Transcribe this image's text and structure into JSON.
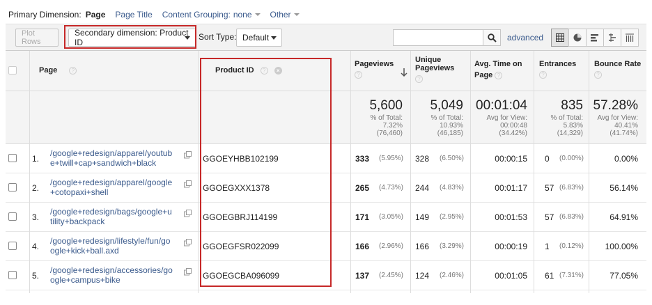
{
  "dimensions": {
    "primary_label": "Primary Dimension:",
    "page": "Page",
    "page_title": "Page Title",
    "content_grouping_label": "Content Grouping:",
    "content_grouping_value": "none",
    "other": "Other"
  },
  "toolbar": {
    "plot_rows": "Plot Rows",
    "secondary_dimension": "Secondary dimension: Product ID",
    "sort_type_label": "Sort Type:",
    "sort_type_value": "Default",
    "search_placeholder": "",
    "advanced": "advanced"
  },
  "columns": {
    "page": "Page",
    "product_id": "Product ID",
    "pageviews": "Pageviews",
    "unique_line1": "Unique",
    "unique_line2": "Pageviews",
    "avg_line1": "Avg. Time on",
    "avg_line2": "Page",
    "entrances": "Entrances",
    "bounce": "Bounce Rate"
  },
  "totals": {
    "pageviews": {
      "big": "5,600",
      "l1": "% of Total:",
      "l2": "7.32%",
      "l3": "(76,460)"
    },
    "unique": {
      "big": "5,049",
      "l1": "% of Total:",
      "l2": "10.93%",
      "l3": "(46,185)"
    },
    "avg": {
      "big": "00:01:04",
      "l1": "Avg for View:",
      "l2": "00:00:48",
      "l3": "(34.42%)"
    },
    "entrances": {
      "big": "835",
      "l1": "% of Total:",
      "l2": "5.83%",
      "l3": "(14,329)"
    },
    "bounce": {
      "big": "57.28%",
      "l1": "Avg for View:",
      "l2": "40.41%",
      "l3": "(41.74%)"
    }
  },
  "rows": [
    {
      "num": "1.",
      "page1": "/google+redesign/apparel/youtub",
      "page2": "e+twill+cap+sandwich+black",
      "product": "GGOEYHBB102199",
      "pv": "333",
      "pv_pct": "(5.95%)",
      "upv": "328",
      "upv_pct": "(6.50%)",
      "avg": "00:00:15",
      "ent": "0",
      "ent_pct": "(0.00%)",
      "bounce": "0.00%"
    },
    {
      "num": "2.",
      "page1": "/google+redesign/apparel/google",
      "page2": "+cotopaxi+shell",
      "product": "GGOEGXXX1378",
      "pv": "265",
      "pv_pct": "(4.73%)",
      "upv": "244",
      "upv_pct": "(4.83%)",
      "avg": "00:01:17",
      "ent": "57",
      "ent_pct": "(6.83%)",
      "bounce": "56.14%"
    },
    {
      "num": "3.",
      "page1": "/google+redesign/bags/google+u",
      "page2": "tility+backpack",
      "product": "GGOEGBRJ114199",
      "pv": "171",
      "pv_pct": "(3.05%)",
      "upv": "149",
      "upv_pct": "(2.95%)",
      "avg": "00:01:53",
      "ent": "57",
      "ent_pct": "(6.83%)",
      "bounce": "64.91%"
    },
    {
      "num": "4.",
      "page1": "/google+redesign/lifestyle/fun/go",
      "page2": "ogle+kick+ball.axd",
      "product": "GGOEGFSR022099",
      "pv": "166",
      "pv_pct": "(2.96%)",
      "upv": "166",
      "upv_pct": "(3.29%)",
      "avg": "00:00:19",
      "ent": "1",
      "ent_pct": "(0.12%)",
      "bounce": "100.00%"
    },
    {
      "num": "5.",
      "page1": "/google+redesign/accessories/go",
      "page2": "ogle+campus+bike",
      "product": "GGOEGCBA096099",
      "pv": "137",
      "pv_pct": "(2.45%)",
      "upv": "124",
      "upv_pct": "(2.46%)",
      "avg": "00:01:05",
      "ent": "61",
      "ent_pct": "(7.31%)",
      "bounce": "77.05%"
    }
  ]
}
